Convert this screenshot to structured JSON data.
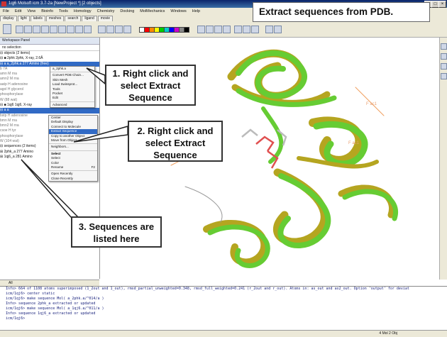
{
  "window": {
    "title": "1qj6 Molsoft icm 3.7-2a  [NewProject *] [2 objects]",
    "min": "_",
    "max": "□",
    "close": "×"
  },
  "menu": [
    "File",
    "Edit",
    "View",
    "Bioinfo",
    "Tools",
    "Homology",
    "Chemistry",
    "Docking",
    "MolMechanics",
    "Windows",
    "Help"
  ],
  "tabs": [
    "display",
    "light",
    "labels",
    "meshes",
    "search",
    "ligand",
    "movie"
  ],
  "slide_title": "Extract sequences from PDB.",
  "workspace": {
    "header": "Workspace Panel",
    "no_selection": "no selection",
    "tree": [
      "⊟ objects  (2 items)",
      "  ⊟ ■ 2phk  2phk, X-ray, 2.6Å",
      "      ⊟ a  a_2phk.a  277 Amino (free)",
      "        b  7A",
      "        amn  M  rna",
      "        amn2  M  rna",
      "        aatp  H  adenosine",
      "        agol  H  glycerol",
      "        phosphorylase",
      "        W  (88 wat)",
      "  ⊟ ■ 1qj6  1qj6, X-ray",
      "      ⊟ a  a",
      "        bstp  H  adenosine",
      "        bmn  M  rna",
      "        bmn2  M  rna",
      "        csoe  H  tyr",
      "        phosphorylase",
      "        W  (104 wat)",
      "⊟ sequences  (2 items)",
      "  ⊞ 2phk_a  277 Amino",
      "  ⊞ 1qj6_a  281 Amino"
    ]
  },
  "menu1": {
    "items": [
      "a_2phk.a",
      "Convert PDB Chain...",
      "Skin Mesh",
      "Load Swissprot...",
      "Tools",
      "Pocket",
      "Edit",
      "Advanced"
    ]
  },
  "menu2": {
    "items": [
      "Center",
      "Default Display",
      "Connect to Molecule",
      "Extract Sequence",
      "Copy to another Object",
      "Move from Object",
      "Neighbors...",
      "Select",
      "Select",
      "Color",
      "Rename",
      "Open Recently",
      "Close Recently"
    ],
    "shortcut": "F2"
  },
  "callouts": {
    "c1": "1. Right click and select Extract Sequence",
    "c2": "2. Right click and select Extract Sequence",
    "c3": "3. Sequences are listed here"
  },
  "labels3d": {
    "fac1": "F ac1",
    "fac2": "F ac1"
  },
  "bottom_tabs": [
    "All"
  ],
  "console": [
    "Info> 664 of 1108 atoms superimposed (1_2out and 1_out), rmsd_partial_unweighted=0.348, rmsd_full_weighted=0.241 (r_2out and r_out). Atoms in: as_out and as2_out.  Option 'output' for deviat",
    "icm/1qj6> center static",
    "icm/1qj6> make sequence Mol( a_2phk.a/^014/a )",
    "  Info> sequence  2phk_a  extracted or updated",
    "icm/1qj6> make sequence Mol( a_1qj6.a/^011/a )",
    "  Info> sequence  1qj6_a  extracted or updated",
    "icm/1qj6>"
  ],
  "status": {
    "right": "4 Mol 2 Obj"
  },
  "colors": {
    "ribbon_green": "#66cc33",
    "ribbon_olive": "#b5a520",
    "accent_blue": "#316ac5"
  }
}
